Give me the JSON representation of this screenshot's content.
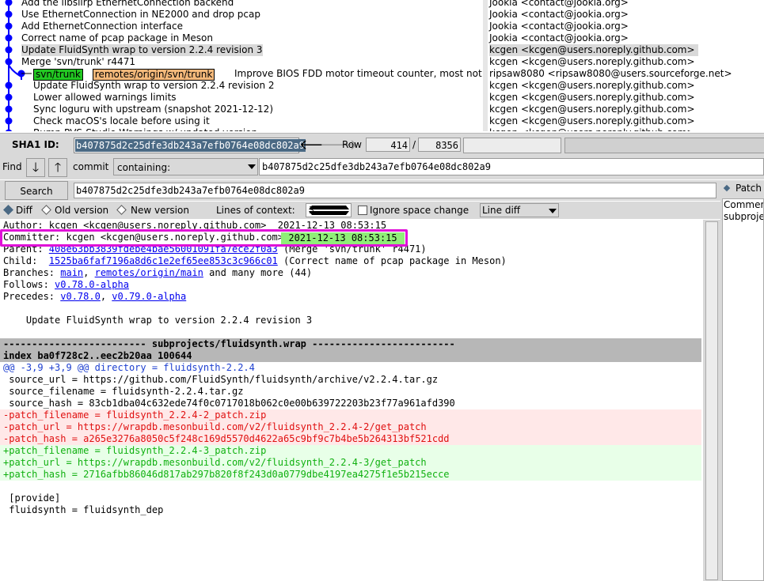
{
  "commits": [
    {
      "subject": "Add the libslirp EthernetConnection backend",
      "author": "Jookia <contact@jookia.org>"
    },
    {
      "subject": "Use EthernetConnection in NE2000 and drop pcap",
      "author": "Jookia <contact@jookia.org>"
    },
    {
      "subject": "Add EthernetConnection interface",
      "author": "Jookia <contact@jookia.org>"
    },
    {
      "subject": "Correct name of pcap package in Meson",
      "author": "Jookia <contact@jookia.org>"
    },
    {
      "subject": "Update FluidSynth wrap to version 2.2.4 revision 3",
      "author": "kcgen <kcgen@users.noreply.github.com>"
    },
    {
      "subject": "Merge 'svn/trunk' r4471",
      "author": "kcgen <kcgen@users.noreply.github.com>"
    },
    {
      "subject": "Improve BIOS FDD motor timeout counter, most not",
      "author": "ripsaw8080 <ripsaw8080@users.sourceforge.net>",
      "refs": [
        "svn/trunk",
        "remotes/origin/svn/trunk"
      ]
    },
    {
      "subject": "Update FluidSynth wrap to version 2.2.4 revision 2",
      "author": "kcgen <kcgen@users.noreply.github.com>"
    },
    {
      "subject": "Lower allowed warnings limits",
      "author": "kcgen <kcgen@users.noreply.github.com>"
    },
    {
      "subject": "Sync loguru with upstream (snapshot 2021-12-12)",
      "author": "kcgen <kcgen@users.noreply.github.com>"
    },
    {
      "subject": "Check macOS's locale before using it",
      "author": "kcgen <kcgen@users.noreply.github.com>"
    },
    {
      "subject": "Bump PVS-Studio Warnings w/ updated version",
      "author": "kcgen <kcgen@users.noreply.github.com>"
    }
  ],
  "sha_bar": {
    "label": "SHA1 ID:",
    "sha": "b407875d2c25dfe3db243a7efb0764e08dc802a9",
    "back_arrow": "🡐",
    "fwd_arrow": "🡒",
    "row_label": "Row",
    "row": "414",
    "separator": "/",
    "total": "8356"
  },
  "find_bar": {
    "label": "Find",
    "down_arrow": "🡓",
    "up_arrow": "🡑",
    "commit_label": "commit",
    "mode": "containing:",
    "query": "b407875d2c25dfe3db243a7efb0764e08dc802a9"
  },
  "search_bar": {
    "button": "Search",
    "query": "b407875d2c25dfe3db243a7efb0764e08dc802a9"
  },
  "options": {
    "diff": "Diff",
    "old_version": "Old version",
    "new_version": "New version",
    "context_label": "Lines of context:",
    "context_value": "3",
    "ignore_space": "Ignore space change",
    "diff_mode": "Line diff"
  },
  "right_panel": {
    "patch_label": "Patch",
    "items": [
      "Comments",
      "subprojects/fluidsynth.wrap"
    ]
  },
  "diff": {
    "author_line": "Author: kcgen <kcgen@users.noreply.github.com>  2021-12-13 08:53:15",
    "committer_line": "Committer: kcgen <kcgen@users.noreply.github.com>",
    "commit_date": "2021-12-13 08:53:15",
    "parent_label": "Parent: ",
    "parent_sha": "408e63bb3839fdebe4bae56001091fa7ece2f0a3",
    "parent_desc": " (Merge 'svn/trunk' r4471)",
    "child_label": "Child:  ",
    "child_sha": "1525ba6faf7196a8d6c1e2ef65ee853c3c966c01",
    "child_desc": " (Correct name of pcap package in Meson)",
    "branches_label": "Branches: ",
    "branch1": "main",
    "branch_sep": ", ",
    "branch2": "remotes/origin/main",
    "branches_more": " and many more (44)",
    "follows_label": "Follows: ",
    "follows": "v0.78.0-alpha",
    "precedes_label": "Precedes: ",
    "precedes1": "v0.78.0",
    "precedes_sep": ", ",
    "precedes2": "v0.79.0-alpha",
    "message": "    Update FluidSynth wrap to version 2.2.4 revision 3",
    "file_header": "------------------------- subprojects/fluidsynth.wrap -------------------------",
    "index_line": "index ba0f728c2..eec2b20aa 100644",
    "hunk": "@@ -3,9 +3,9 @@ directory = fluidsynth-2.2.4",
    "ctx1": " source_url = https://github.com/FluidSynth/fluidsynth/archive/v2.2.4.tar.gz",
    "ctx2": " source_filename = fluidsynth-2.2.4.tar.gz",
    "ctx3": " source_hash = 83cb1dba04c632ede74f0c0717018b062c0e00b639722203b23f77a961afd390",
    "del1": "-patch_filename = fluidsynth_2.2.4-2_patch.zip",
    "del2": "-patch_url = https://wrapdb.mesonbuild.com/v2/fluidsynth_2.2.4-2/get_patch",
    "del3": "-patch_hash = a265e3276a8050c5f248c169d5570d4622a65c9bf9c7b4be5b264313bf521cdd",
    "add1": "+patch_filename = fluidsynth_2.2.4-3_patch.zip",
    "add2": "+patch_url = https://wrapdb.mesonbuild.com/v2/fluidsynth_2.2.4-3/get_patch",
    "add3": "+patch_hash = 2716afbb86046d817ab297b820f8f243d0a0779dbe4197ea4275f1e5b215ecce",
    "ctx4": " [provide]",
    "ctx5": " fluidsynth = fluidsynth_dep"
  },
  "colors": {
    "graph_line": "#0000ff",
    "branch_tag": "#22c722",
    "remote_tag": "#f3b87a",
    "highlight_box": "#e010d8",
    "date_highlight": "#90ee78",
    "selection": "#4a6984"
  }
}
